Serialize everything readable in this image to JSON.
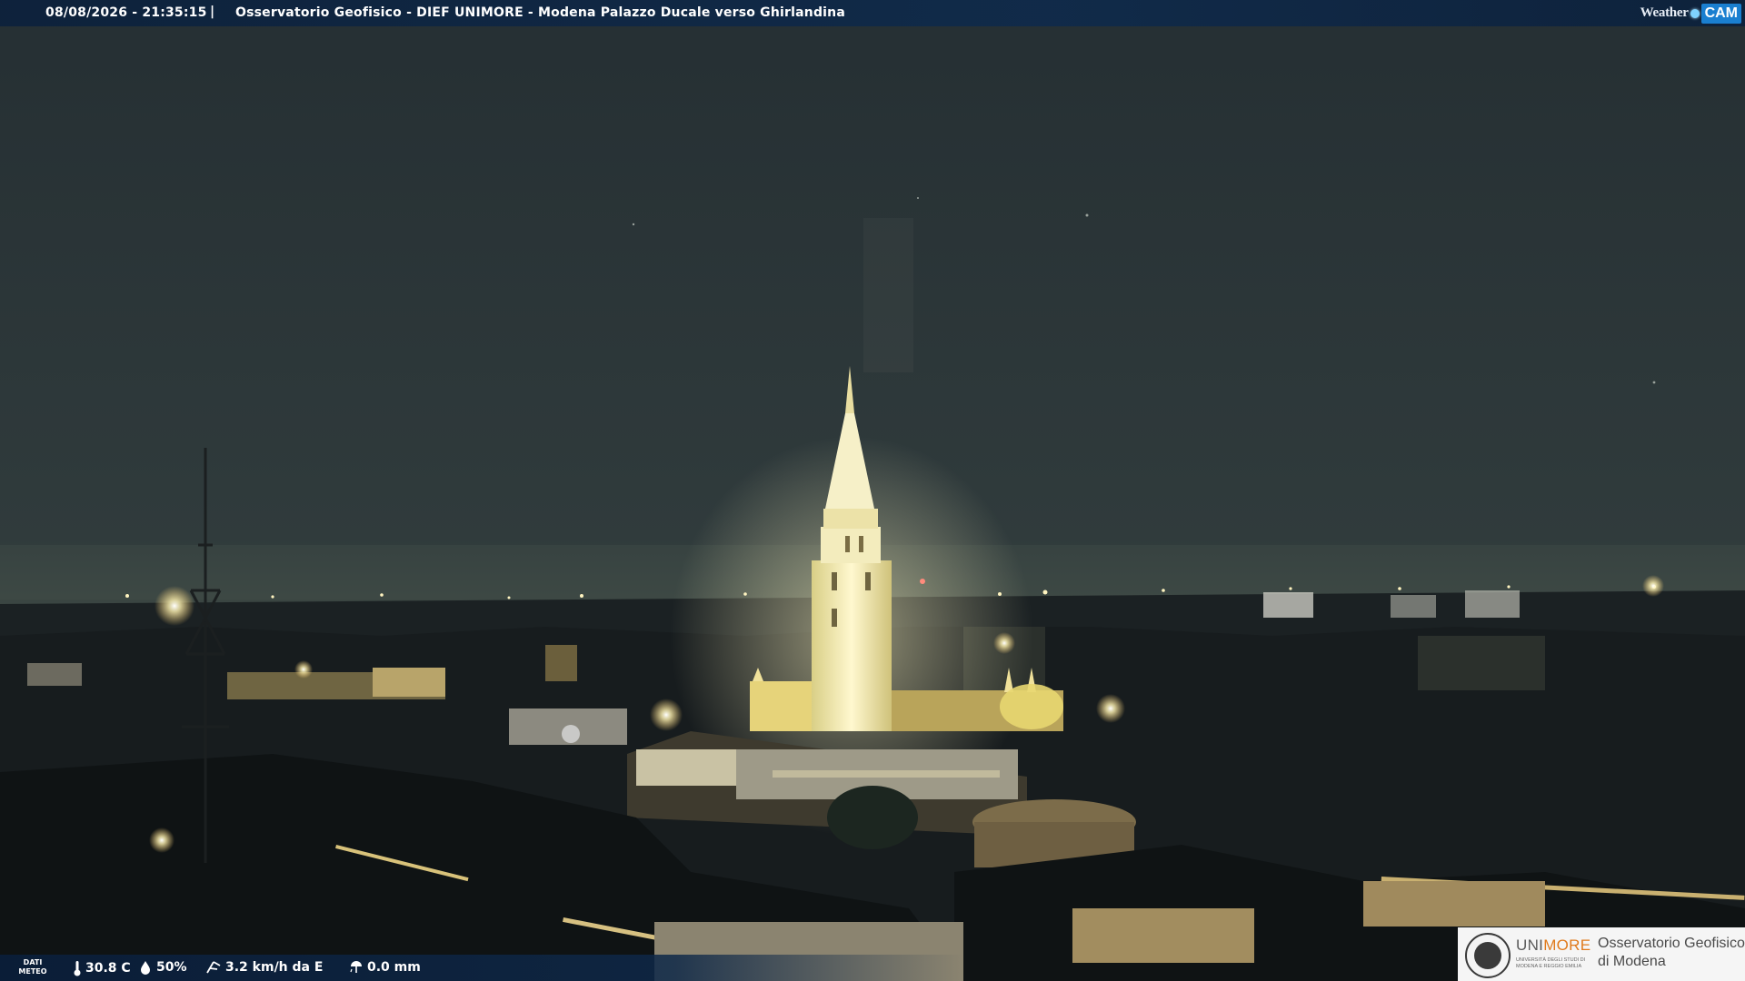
{
  "overlay_top": {
    "datetime": "08/08/2026 - 21:35:15",
    "separator": "|",
    "title": "Osservatorio Geofisico - DIEF UNIMORE - Modena Palazzo Ducale verso Ghirlandina",
    "brand_weather": "Weather",
    "brand_cam": "CAM"
  },
  "overlay_bottom": {
    "label_line1": "DATI",
    "label_line2": "METEO",
    "temperature": "30.8 C",
    "humidity": "50%",
    "wind": "3.2 km/h da E",
    "rain": "0.0 mm",
    "icons": {
      "temperature": "thermometer-icon",
      "humidity": "droplet-icon",
      "wind": "wind-icon",
      "rain": "rain-gauge-icon"
    }
  },
  "logo": {
    "uni": "UNI",
    "more": "MORE",
    "subtitle": "UNIVERSITÀ DEGLI STUDI DI MODENA E REGGIO EMILIA",
    "obs_line1": "Osservatorio Geofisico",
    "obs_line2": "di Modena"
  },
  "scene": {
    "description_colors": {
      "sky_top": "#2a3437",
      "sky_horizon": "#3a4544",
      "tower_light": "#fff3b0",
      "city_dark": "#141a1c"
    }
  }
}
